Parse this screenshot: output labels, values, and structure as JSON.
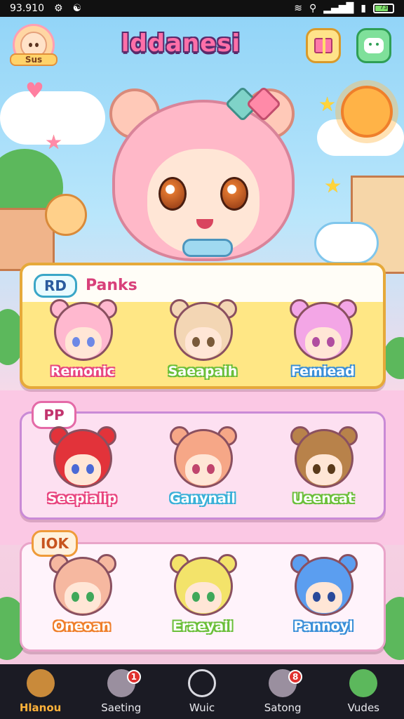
{
  "status_bar": {
    "time": "93.910",
    "battery": "73"
  },
  "header": {
    "profile_label": "Sus",
    "logo_text": "lddanesi"
  },
  "cards": [
    {
      "badge": "RD",
      "title": "Panks",
      "characters": [
        {
          "name": "Remonic",
          "hair": "#ffb8cf",
          "eye": "#6d88e6",
          "name_color": "#e8457f"
        },
        {
          "name": "Saeapaih",
          "hair": "#f3d6b4",
          "eye": "#7a5a3a",
          "name_color": "#6bbf3a"
        },
        {
          "name": "Femiead",
          "hair": "#f3a6e6",
          "eye": "#b04da0",
          "name_color": "#3a8fd8"
        }
      ]
    },
    {
      "badge": "PP",
      "characters": [
        {
          "name": "Seepialip",
          "hair": "#e2333a",
          "eye": "#4a6ad6",
          "name_color": "#e8457f"
        },
        {
          "name": "Ganynail",
          "hair": "#f6a787",
          "eye": "#c0456d",
          "name_color": "#3ab0d8"
        },
        {
          "name": "Ueencat",
          "hair": "#b8824a",
          "eye": "#5a3a1a",
          "name_color": "#6bbf3a"
        }
      ]
    },
    {
      "badge": "IOK",
      "characters": [
        {
          "name": "Oneoan",
          "hair": "#f6b8a0",
          "eye": "#3fa85a",
          "name_color": "#ef7f2b"
        },
        {
          "name": "Eraeyail",
          "hair": "#f3e36a",
          "eye": "#3fa85a",
          "name_color": "#6bbf3a"
        },
        {
          "name": "Pannoyl",
          "hair": "#5b9ef0",
          "eye": "#2a4a9a",
          "name_color": "#3a8fd8"
        }
      ]
    }
  ],
  "nav": [
    {
      "label": "Hlanou",
      "icon": "home-hat-icon",
      "badge": "",
      "active": true
    },
    {
      "label": "Saeting",
      "icon": "cat-icon",
      "badge": "1",
      "active": false
    },
    {
      "label": "Wuic",
      "icon": "compass-icon",
      "badge": "",
      "active": false
    },
    {
      "label": "Satong",
      "icon": "cat-icon",
      "badge": "8",
      "active": false
    },
    {
      "label": "Vudes",
      "icon": "frog-icon",
      "badge": "",
      "active": false
    }
  ]
}
